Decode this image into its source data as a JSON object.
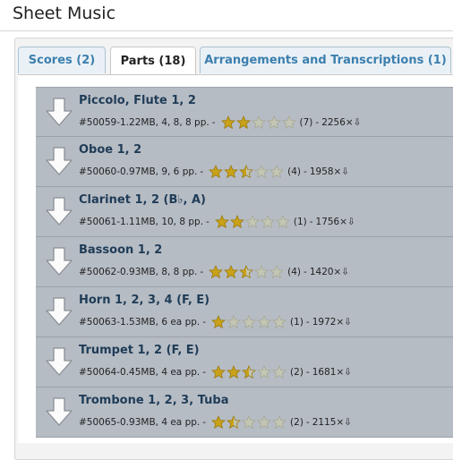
{
  "page": {
    "title": "Sheet Music"
  },
  "tabs": [
    {
      "label": "Scores (2)",
      "active": false
    },
    {
      "label": "Parts (18)",
      "active": true
    },
    {
      "label": "Arrangements and Transcriptions (1)",
      "active": false
    }
  ],
  "parts": [
    {
      "name": "Piccolo, Flute 1, 2",
      "id": "#50059",
      "details": "1.22MB, 4, 8, 8 pp.",
      "rating": 2,
      "votes": "(7)",
      "downloads": "2256×⇩"
    },
    {
      "name": "Oboe 1, 2",
      "id": "#50060",
      "details": "0.97MB, 9, 6 pp.",
      "rating": 2.5,
      "votes": "(4)",
      "downloads": "1958×⇩"
    },
    {
      "name": "Clarinet 1, 2 (B♭, A)",
      "id": "#50061",
      "details": "1.11MB, 10, 8 pp.",
      "rating": 2,
      "votes": "(1)",
      "downloads": "1756×⇩"
    },
    {
      "name": "Bassoon 1, 2",
      "id": "#50062",
      "details": "0.93MB, 8, 8 pp.",
      "rating": 2.5,
      "votes": "(4)",
      "downloads": "1420×⇩"
    },
    {
      "name": "Horn 1, 2, 3, 4 (F, E)",
      "id": "#50063",
      "details": "1.53MB, 6 ea pp.",
      "rating": 1,
      "votes": "(1)",
      "downloads": "1972×⇩"
    },
    {
      "name": "Trumpet 1, 2 (F, E)",
      "id": "#50064",
      "details": "0.45MB, 4 ea pp.",
      "rating": 2.5,
      "votes": "(2)",
      "downloads": "1681×⇩"
    },
    {
      "name": "Trombone 1, 2, 3, Tuba",
      "id": "#50065",
      "details": "0.93MB, 4 ea pp.",
      "rating": 1.5,
      "votes": "(2)",
      "downloads": "2115×⇩"
    }
  ],
  "colors": {
    "star_gold": "#c9a218",
    "star_empty": "#c4c6b4",
    "row_bg": "#b6bcc4",
    "tab_link": "#3c7fae"
  },
  "icons": {
    "download": "download-arrow-icon",
    "star": "star-icon"
  }
}
